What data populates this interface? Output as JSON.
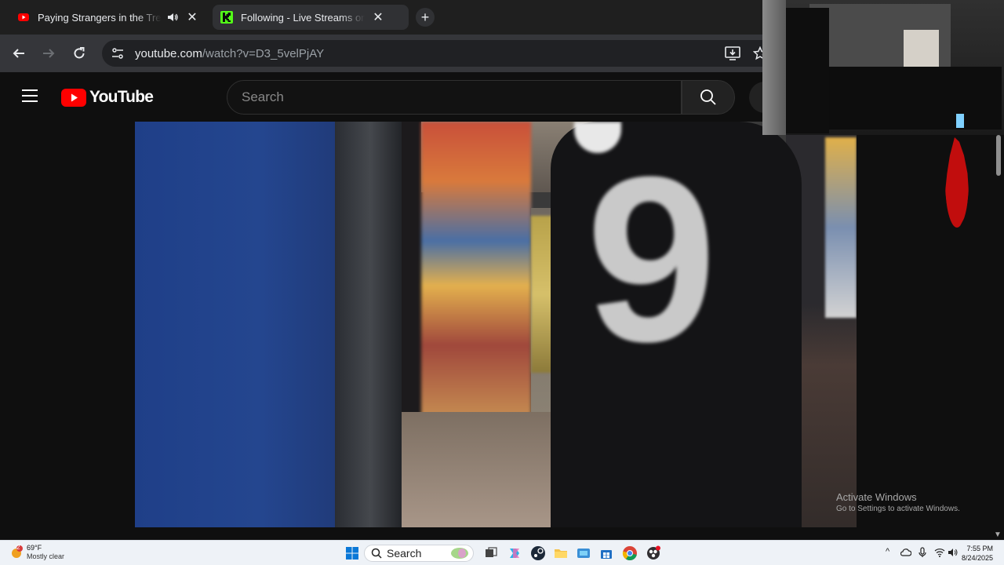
{
  "browser": {
    "tabs": [
      {
        "title": "Paying Strangers in the Trenches",
        "favicon": "youtube-favicon",
        "audio": true,
        "active": true
      },
      {
        "title": "Following - Live Streams on Kick",
        "favicon": "kick-favicon",
        "audio": false,
        "active": false
      }
    ],
    "omnibox": {
      "host": "youtube.com",
      "path": "/watch?v=D3_5velPjAY"
    }
  },
  "youtube": {
    "logo_text": "YouTube",
    "search_placeholder": "Search"
  },
  "video": {
    "overlay_graphic": "9"
  },
  "watermark": {
    "heading": "Activate Windows",
    "subtext": "Go to Settings to activate Windows."
  },
  "taskbar": {
    "weather": {
      "badge": "2",
      "temp": "69°F",
      "condition": "Mostly clear"
    },
    "search_label": "Search",
    "clock": {
      "time": "7:55 PM",
      "date": "8/24/2025"
    },
    "icons": [
      "windows-start-icon",
      "search-icon",
      "task-view-icon",
      "copilot-icon",
      "steam-icon",
      "file-explorer-icon",
      "edge-icon",
      "store-icon",
      "chrome-icon",
      "obs-icon"
    ]
  },
  "colors": {
    "youtube_red": "#ff0000",
    "kick_green": "#53fc18",
    "page_bg": "#0f0f0f"
  }
}
